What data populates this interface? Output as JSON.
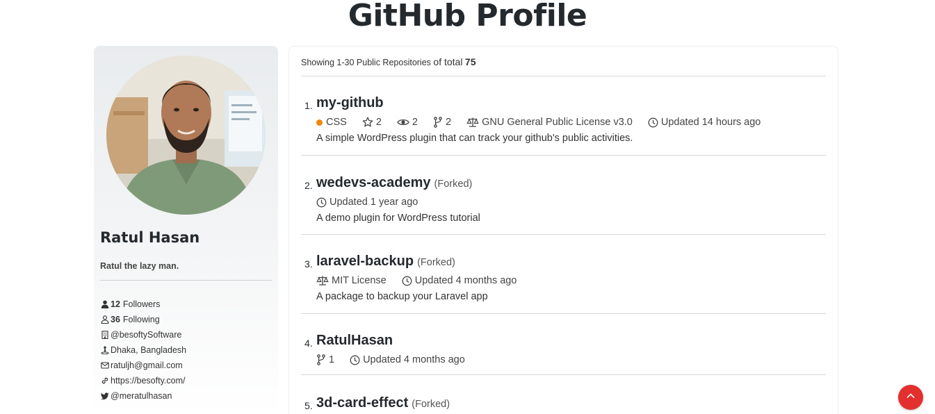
{
  "page": {
    "title": "GitHub Profile"
  },
  "profile": {
    "name": "Ratul Hasan",
    "bio": "Ratul the lazy man.",
    "followers": {
      "count": "12",
      "label": "Followers"
    },
    "following": {
      "count": "36",
      "label": "Following"
    },
    "company": "@besoftySoftware",
    "location": "Dhaka, Bangladesh",
    "email": "ratuljh@gmail.com",
    "website": "https://besofty.com/",
    "twitter": "@meratulhasan"
  },
  "repos": {
    "summary_prefix": "Showing 1-30 Public Repositories",
    "summary_middle": "of total",
    "summary_total": "75",
    "items": [
      {
        "number": "1.",
        "name": "my-github",
        "forked": "",
        "language": "CSS",
        "language_color": "#f1880a",
        "stars": "2",
        "watchers": "2",
        "forks": "2",
        "license": "GNU General Public License v3.0",
        "updated": "Updated 14 hours ago",
        "description": "A simple WordPress plugin that can track your github's public activities."
      },
      {
        "number": "2.",
        "name": "wedevs-academy",
        "forked": "(Forked)",
        "updated": "Updated 1 year ago",
        "description": "A demo plugin for WordPress tutorial"
      },
      {
        "number": "3.",
        "name": "laravel-backup",
        "forked": "(Forked)",
        "license": "MIT License",
        "updated": "Updated 4 months ago",
        "description": "A package to backup your Laravel app"
      },
      {
        "number": "4.",
        "name": "RatulHasan",
        "forked": "",
        "forks": "1",
        "updated": "Updated 4 months ago"
      },
      {
        "number": "5.",
        "name": "3d-card-effect",
        "forked": "(Forked)"
      }
    ]
  },
  "colors": {
    "accent_scroll": "#e3302f",
    "language_css": "#f1880a"
  },
  "icons": {
    "followers": "user-solid-icon",
    "following": "user-outline-icon",
    "company": "building-icon",
    "location": "person-pin-icon",
    "email": "envelope-icon",
    "website": "link-icon",
    "twitter": "twitter-icon",
    "scroll_top": "chevron-up-icon"
  }
}
